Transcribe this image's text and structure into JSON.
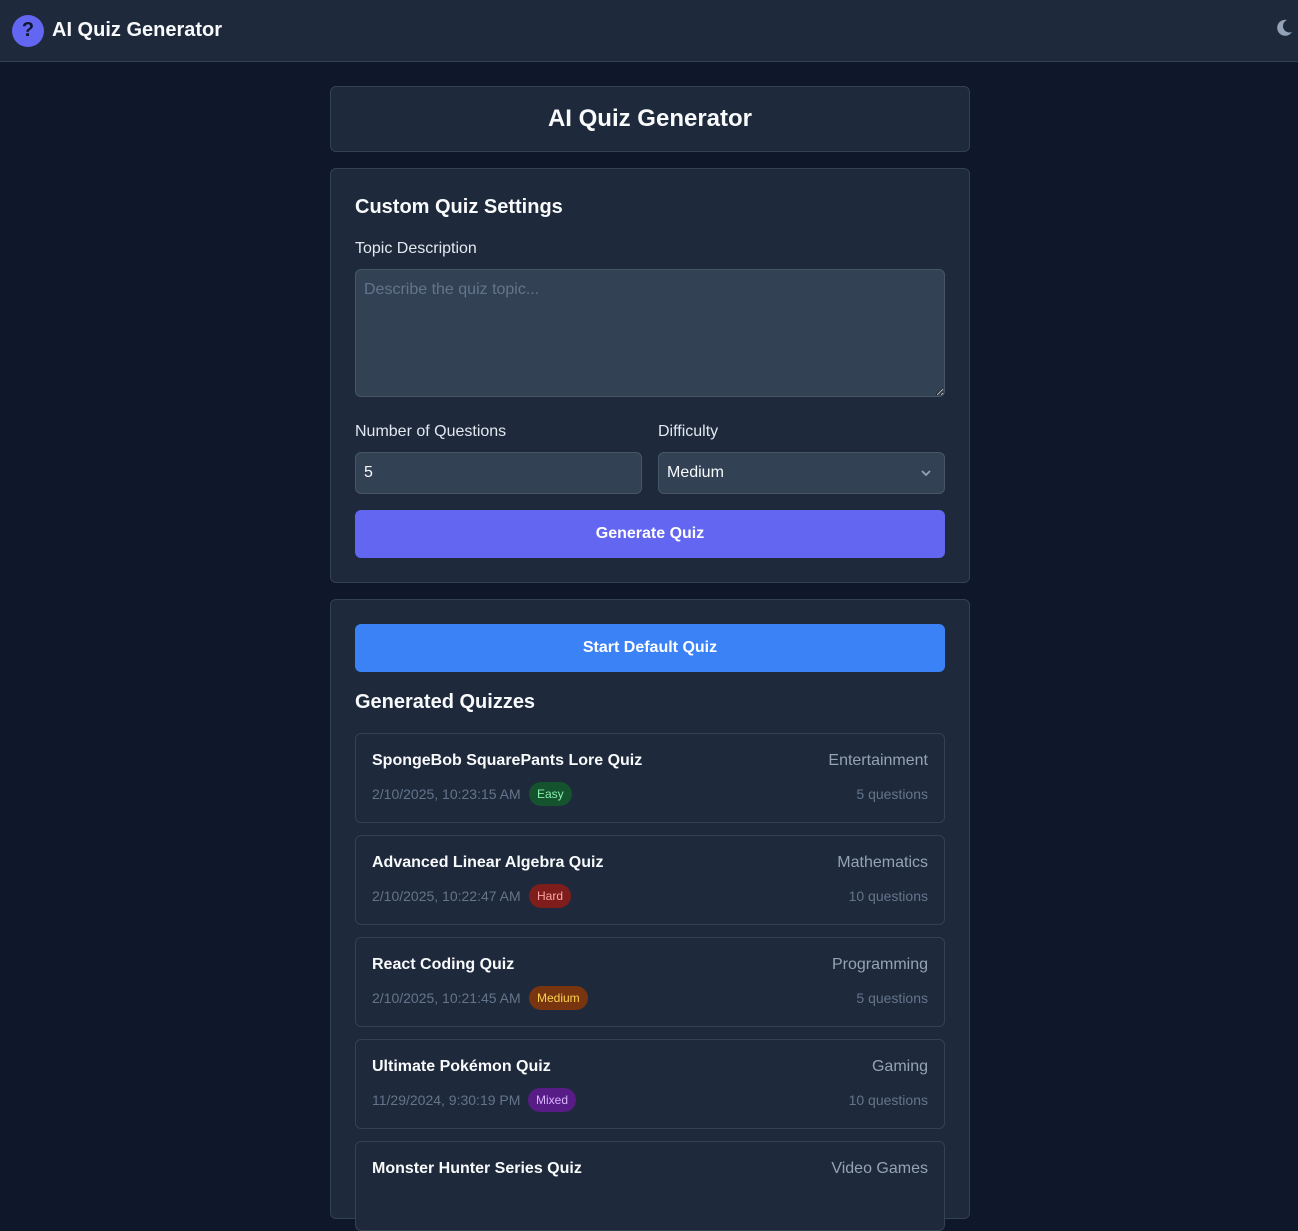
{
  "topbar": {
    "title": "AI Quiz Generator",
    "logo_glyph": "?",
    "logo_icon": "question-mark-icon",
    "theme_icon": "moon-icon"
  },
  "header": {
    "title": "AI Quiz Generator"
  },
  "settings": {
    "title": "Custom Quiz Settings",
    "topic_label": "Topic Description",
    "topic_placeholder": "Describe the quiz topic...",
    "topic_value": "",
    "questions_label": "Number of Questions",
    "questions_value": "5",
    "difficulty_label": "Difficulty",
    "difficulty_value": "Medium",
    "generate_label": "Generate Quiz"
  },
  "list": {
    "default_button_label": "Start Default Quiz",
    "title": "Generated Quizzes",
    "quizzes": [
      {
        "title": "SpongeBob SquarePants Lore Quiz",
        "category": "Entertainment",
        "date": "2/10/2025, 10:23:15 AM",
        "difficulty": "Easy",
        "count": "5 questions",
        "badge_bg": "#14532d",
        "badge_fg": "#86efac"
      },
      {
        "title": "Advanced Linear Algebra Quiz",
        "category": "Mathematics",
        "date": "2/10/2025, 10:22:47 AM",
        "difficulty": "Hard",
        "count": "10 questions",
        "badge_bg": "#7f1d1d",
        "badge_fg": "#fca5a5"
      },
      {
        "title": "React Coding Quiz",
        "category": "Programming",
        "date": "2/10/2025, 10:21:45 AM",
        "difficulty": "Medium",
        "count": "5 questions",
        "badge_bg": "#78350f",
        "badge_fg": "#fcd34d"
      },
      {
        "title": "Ultimate Pokémon Quiz",
        "category": "Gaming",
        "date": "11/29/2024, 9:30:19 PM",
        "difficulty": "Mixed",
        "count": "10 questions",
        "badge_bg": "#581c87",
        "badge_fg": "#d8b4fe"
      },
      {
        "title": "Monster Hunter Series Quiz",
        "category": "Video Games",
        "date": "",
        "difficulty": "",
        "count": "",
        "badge_bg": "",
        "badge_fg": ""
      }
    ]
  },
  "colors": {
    "background": "#0f172a",
    "card": "#1e293b",
    "accent": "#6366f1",
    "primary_blue": "#3b82f6"
  }
}
